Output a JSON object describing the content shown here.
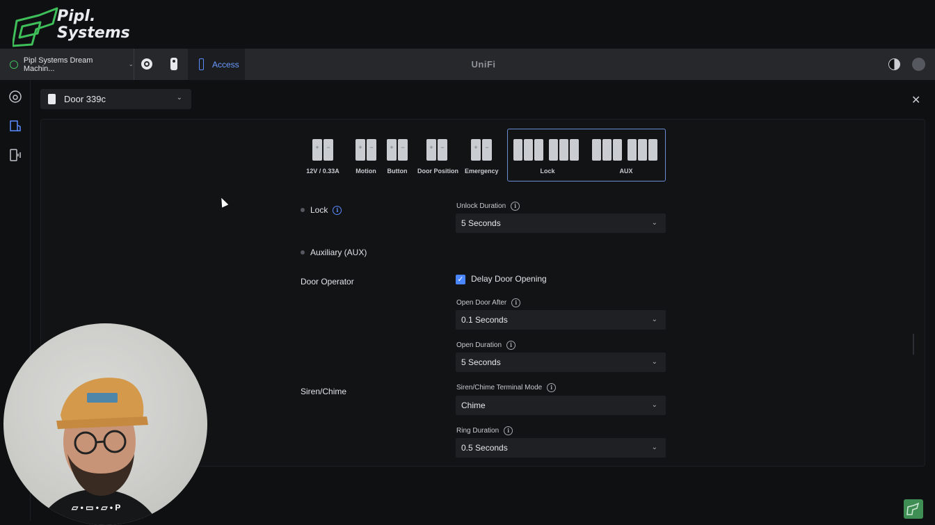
{
  "logo": {
    "line1": "Pipl.",
    "line2": "Systems"
  },
  "topbar": {
    "site_name": "Pipl Systems Dream Machin...",
    "access_label": "Access",
    "brand": "UniFi"
  },
  "icons": {
    "site": "globe-icon",
    "protect": "camera-icon",
    "doorbell": "doorbell-icon",
    "access": "access-icon",
    "theme": "theme-toggle-icon",
    "user": "user-avatar-icon",
    "sidebar": [
      "activity-icon",
      "door-map-icon",
      "devices-icon"
    ],
    "close": "close-icon"
  },
  "door_selector": {
    "value": "Door 339c"
  },
  "terminals": [
    {
      "label": "12V / 0.33A",
      "pins": [
        "+",
        "−"
      ]
    },
    {
      "label": "Motion",
      "pins": [
        "+",
        "−"
      ]
    },
    {
      "label": "Button",
      "pins": [
        "+",
        "−"
      ]
    },
    {
      "label": "Door Position",
      "pins": [
        "+",
        "−"
      ]
    },
    {
      "label": "Emergency",
      "pins": [
        "+",
        "−"
      ]
    },
    {
      "label": "Lock",
      "pins": [
        "",
        "",
        "",
        "",
        "",
        ""
      ]
    },
    {
      "label": "AUX",
      "pins": [
        "",
        "",
        "",
        "",
        "",
        ""
      ]
    }
  ],
  "sections": {
    "lock": "Lock",
    "aux": "Auxiliary (AUX)",
    "door_operator": "Door Operator",
    "siren_chime": "Siren/Chime"
  },
  "fields": {
    "unlock_duration": {
      "label": "Unlock Duration",
      "value": "5 Seconds"
    },
    "delay_door_opening": {
      "label": "Delay Door Opening",
      "checked": true
    },
    "open_door_after": {
      "label": "Open Door After",
      "value": "0.1 Seconds"
    },
    "open_duration": {
      "label": "Open Duration",
      "value": "5 Seconds"
    },
    "siren_mode": {
      "label": "Siren/Chime Terminal Mode",
      "value": "Chime"
    },
    "ring_duration": {
      "label": "Ring Duration",
      "value": "0.5 Seconds"
    }
  },
  "webcam": {
    "caption": "P"
  },
  "colors": {
    "accent": "#5b8cff",
    "checkbox": "#4a86ff",
    "brand_green": "#3fbf5a"
  }
}
